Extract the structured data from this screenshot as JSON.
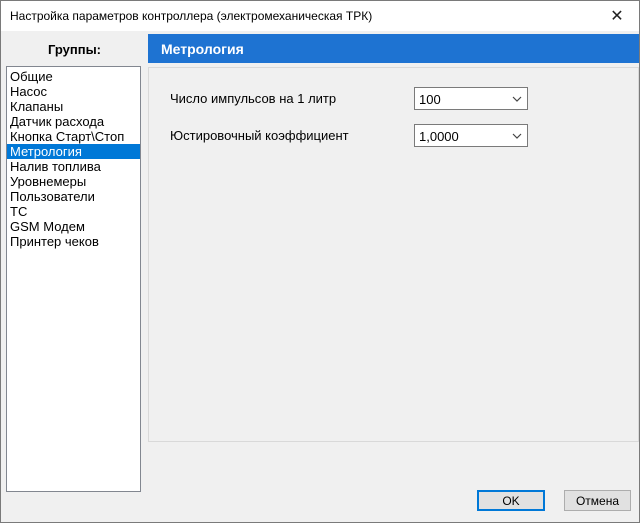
{
  "window": {
    "title": "Настройка параметров контроллера (электромеханическая ТРК)",
    "close_glyph": "✕"
  },
  "sidebar": {
    "header": "Группы:",
    "items": [
      {
        "label": "Общие",
        "selected": false
      },
      {
        "label": "Насос",
        "selected": false
      },
      {
        "label": "Клапаны",
        "selected": false
      },
      {
        "label": "Датчик расхода",
        "selected": false
      },
      {
        "label": "Кнопка Старт\\Стоп",
        "selected": false
      },
      {
        "label": "Метрология",
        "selected": true
      },
      {
        "label": "Налив топлива",
        "selected": false
      },
      {
        "label": "Уровнемеры",
        "selected": false
      },
      {
        "label": "Пользователи",
        "selected": false
      },
      {
        "label": "ТС",
        "selected": false
      },
      {
        "label": "GSM Модем",
        "selected": false
      },
      {
        "label": "Принтер чеков",
        "selected": false
      }
    ]
  },
  "panel": {
    "title": "Метрология",
    "fields": [
      {
        "label": "Число импульсов на 1 литр",
        "value": "100"
      },
      {
        "label": "Юстировочный коэффициент",
        "value": "1,0000"
      }
    ]
  },
  "buttons": {
    "ok": "OK",
    "cancel": "Отмена"
  },
  "colors": {
    "accent": "#0078d7",
    "header_bar": "#1e73d2"
  }
}
